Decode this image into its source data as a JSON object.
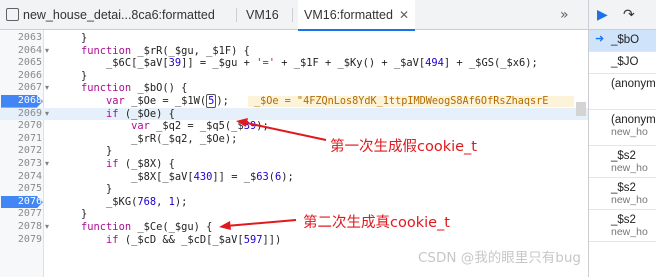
{
  "tabs": [
    {
      "label": "new_house_detai...8ca6:formatted",
      "active": false
    },
    {
      "label": "VM16",
      "active": false
    },
    {
      "label": "VM16:formatted",
      "active": true
    }
  ],
  "tab_overflow": "»",
  "debug_toolbar": {
    "resume_icon": "resume-icon",
    "step_over_icon": "step-over-icon"
  },
  "code_lines": [
    {
      "num": "2063",
      "text": "    }"
    },
    {
      "num": "2064",
      "text": "    function _$rR(_$gu, _$1F) {"
    },
    {
      "num": "2065",
      "text": "        _$6C[_$aV[39]] = _$gu + '=' + _$1F + _$Ky() + _$aV[494] + _$GS(_$x6);"
    },
    {
      "num": "2066",
      "text": "    }"
    },
    {
      "num": "2067",
      "text": "    function _$bO() {"
    },
    {
      "num": "2068",
      "text": "        var _$Oe = _$1W(5);"
    },
    {
      "num": "2069",
      "text": "        if (_$Oe) {"
    },
    {
      "num": "2070",
      "text": "            var _$q2 = _$q5(_$39);"
    },
    {
      "num": "2071",
      "text": "            _$rR(_$q2, _$Oe);"
    },
    {
      "num": "2072",
      "text": "        }"
    },
    {
      "num": "2073",
      "text": "        if (_$8X) {"
    },
    {
      "num": "2074",
      "text": "            _$8X[_$aV[430]] = _$63(6);"
    },
    {
      "num": "2075",
      "text": "        }"
    },
    {
      "num": "2076",
      "text": "        _$KG(768, 1);"
    },
    {
      "num": "2077",
      "text": "    }"
    },
    {
      "num": "2078",
      "text": "    function _$Ce(_$gu) {"
    },
    {
      "num": "2079",
      "text": "        if (_$cD && _$cD[_$aV[597]])"
    }
  ],
  "inline_value": "_$Oe = \"4FZQnLos8YdK_1ttpIMDWeogS8Af6OfRsZhaqsrE",
  "breakpoint_lines": [
    "2068",
    "2076"
  ],
  "current_line": "2069",
  "annotations": {
    "first": "第一次生成假cookie_t",
    "second": "第二次生成真cookie_t"
  },
  "watermark": "CSDN @我的眼里只有bug",
  "call_stack": [
    {
      "name": "_$bO",
      "sub": "",
      "selected": true
    },
    {
      "name": "_$JO",
      "sub": "",
      "selected": false
    },
    {
      "name": "(anonym",
      "sub": "",
      "selected": false
    },
    {
      "name": "(anonym",
      "sub": "new_ho",
      "selected": false
    },
    {
      "name": "_$s2",
      "sub": "new_ho",
      "selected": false
    },
    {
      "name": "_$s2",
      "sub": "new_ho",
      "selected": false
    },
    {
      "name": "_$s2",
      "sub": "new_ho",
      "selected": false
    }
  ],
  "colors": {
    "accent": "#1a73e8",
    "breakpoint": "#4285f4",
    "annotation": "#e0191e",
    "inline_value_bg": "#fdf3d8"
  }
}
